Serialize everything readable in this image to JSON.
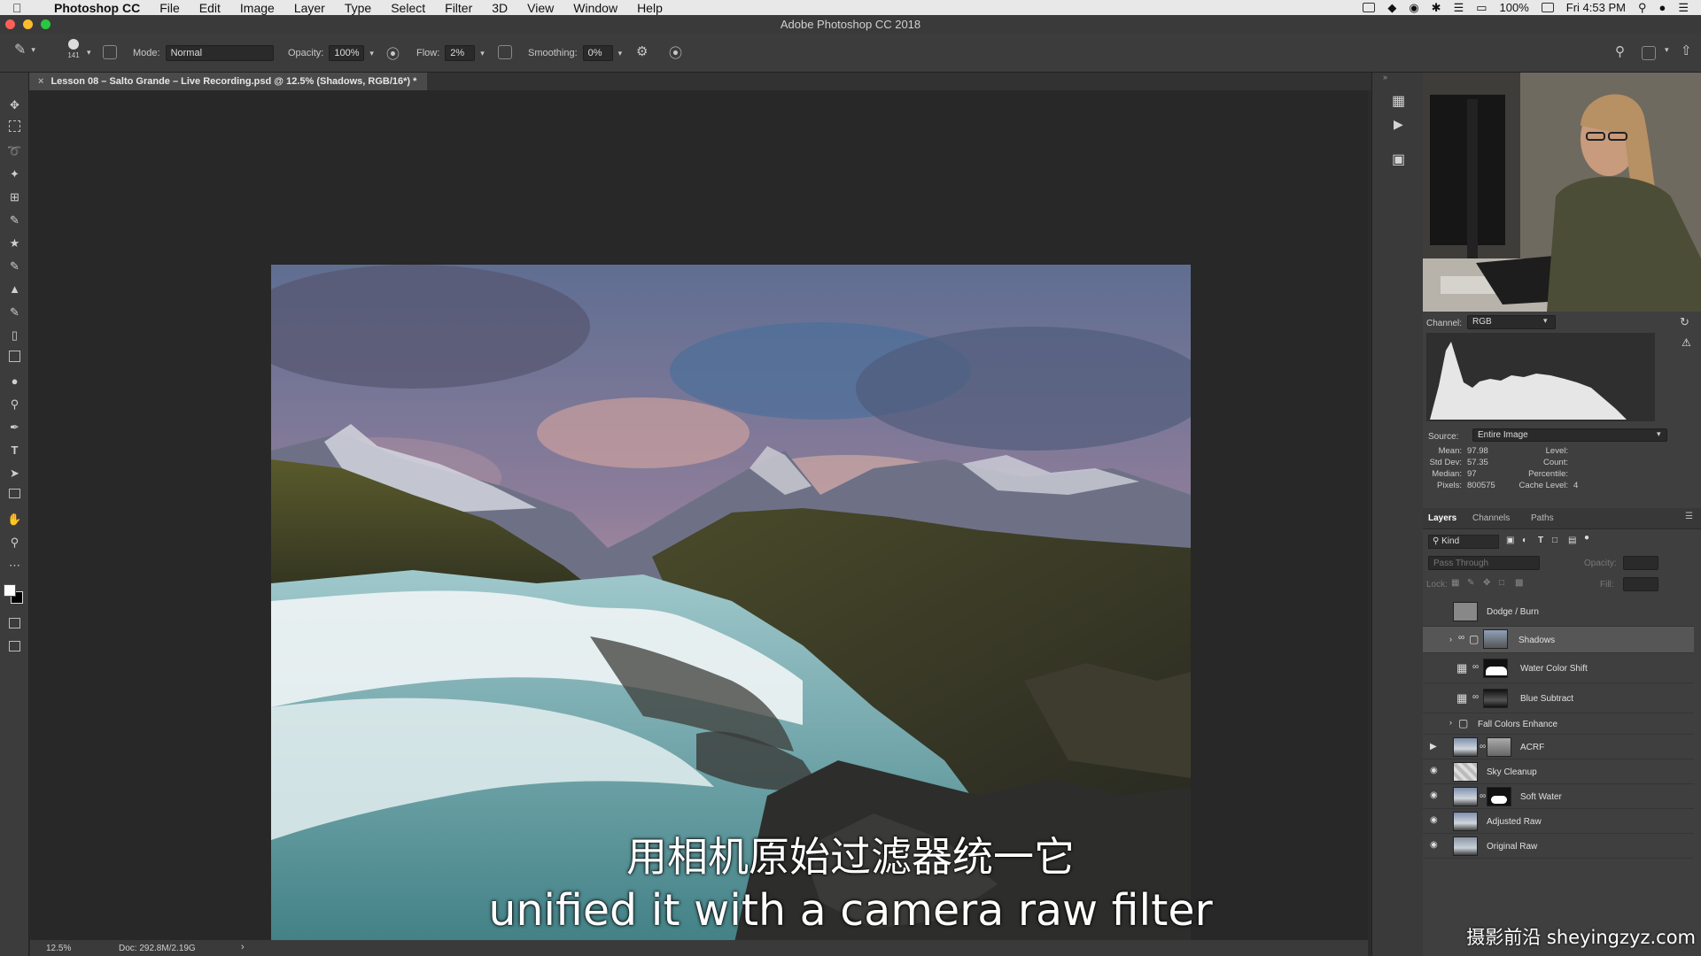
{
  "menubar": {
    "app": "Photoshop CC",
    "items": [
      "File",
      "Edit",
      "Image",
      "Layer",
      "Type",
      "Select",
      "Filter",
      "3D",
      "View",
      "Window",
      "Help"
    ],
    "battery": "100%",
    "clock": "Fri 4:53 PM"
  },
  "window": {
    "title": "Adobe Photoshop CC 2018"
  },
  "options": {
    "brush_size": "141",
    "mode_label": "Mode:",
    "mode_value": "Normal",
    "opacity_label": "Opacity:",
    "opacity_value": "100%",
    "flow_label": "Flow:",
    "flow_value": "2%",
    "smoothing_label": "Smoothing:",
    "smoothing_value": "0%"
  },
  "document": {
    "tab_title": "Lesson 08 – Salto Grande – Live Recording.psd @ 12.5% (Shadows, RGB/16*) *"
  },
  "status": {
    "zoom": "12.5%",
    "doc": "Doc: 292.8M/2.19G"
  },
  "histogram": {
    "channel_label": "Channel:",
    "channel_value": "RGB",
    "source_label": "Source:",
    "source_value": "Entire Image",
    "stats": {
      "mean_label": "Mean:",
      "mean": "97.98",
      "stddev_label": "Std Dev:",
      "stddev": "57.35",
      "median_label": "Median:",
      "median": "97",
      "pixels_label": "Pixels:",
      "pixels": "800575",
      "level_label": "Level:",
      "count_label": "Count:",
      "percentile_label": "Percentile:",
      "cache_label": "Cache Level:",
      "cache": "4"
    }
  },
  "layers_panel": {
    "tabs": [
      "Layers",
      "Channels",
      "Paths"
    ],
    "kind": "Kind",
    "blend": "Pass Through",
    "opacity_label": "Opacity:",
    "lock_label": "Lock:",
    "fill_label": "Fill:",
    "layers": [
      {
        "name": "Dodge / Burn"
      },
      {
        "name": "Shadows"
      },
      {
        "name": "Water Color Shift"
      },
      {
        "name": "Blue Subtract"
      },
      {
        "name": "Fall Colors Enhance"
      },
      {
        "name": "ACRF"
      },
      {
        "name": "Sky Cleanup"
      },
      {
        "name": "Soft Water"
      },
      {
        "name": "Adjusted Raw"
      },
      {
        "name": "Original Raw"
      }
    ]
  },
  "subtitles": {
    "chinese": "用相机原始过滤器统一它",
    "english": "unified it with a camera raw filter"
  },
  "watermark": "摄影前沿 sheyingzyz.com"
}
